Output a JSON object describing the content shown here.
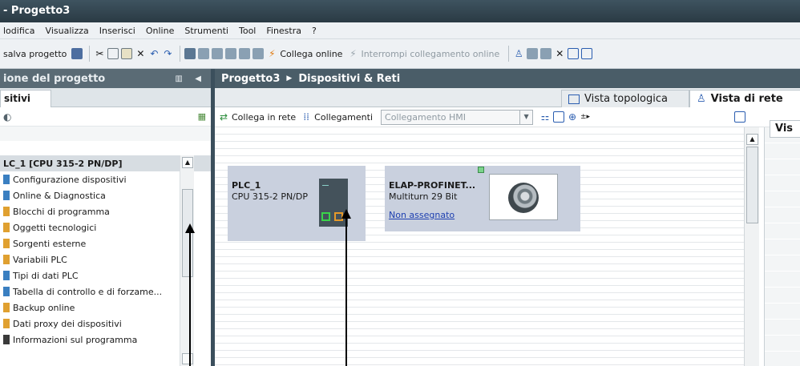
{
  "window": {
    "title": "- Progetto3"
  },
  "menu": [
    "lodifica",
    "Visualizza",
    "Inserisci",
    "Online",
    "Strumenti",
    "Tool",
    "Finestra",
    "?"
  ],
  "toolbar": {
    "save_label": "salva progetto",
    "connect_online_label": "Collega online",
    "disconnect_online_label": "Interrompi collegamento online"
  },
  "project_tree": {
    "header": "ione del progetto",
    "tab_label": "sitivi",
    "items": [
      {
        "label": "LC_1 [CPU 315-2 PN/DP]",
        "icon_color": "#c9d0de"
      },
      {
        "label": "Configurazione dispositivi",
        "icon_color": "#3a7fc1"
      },
      {
        "label": "Online & Diagnostica",
        "icon_color": "#3a7fc1"
      },
      {
        "label": "Blocchi di programma",
        "icon_color": "#e0a030"
      },
      {
        "label": "Oggetti tecnologici",
        "icon_color": "#e0a030"
      },
      {
        "label": "Sorgenti esterne",
        "icon_color": "#e0a030"
      },
      {
        "label": "Variabili PLC",
        "icon_color": "#e0a030"
      },
      {
        "label": "Tipi di dati PLC",
        "icon_color": "#3a7fc1"
      },
      {
        "label": "Tabella di controllo e di forzame...",
        "icon_color": "#3a7fc1"
      },
      {
        "label": "Backup online",
        "icon_color": "#e0a030"
      },
      {
        "label": "Dati proxy dei dispositivi",
        "icon_color": "#e0a030"
      },
      {
        "label": "Informazioni sul programma",
        "icon_color": "#3a3a3a"
      }
    ]
  },
  "editor": {
    "breadcrumb_project": "Progetto3",
    "breadcrumb_section": "Dispositivi & Reti",
    "tab_topology": "Vista topologica",
    "tab_network": "Vista di rete",
    "tab_table": "Vis",
    "connect_network_label": "Collega in rete",
    "connections_label": "Collegamenti",
    "connection_type_value": "Collegamento HMI"
  },
  "devices": {
    "plc": {
      "name": "PLC_1",
      "type": "CPU 315-2 PN/DP"
    },
    "elap": {
      "name": "ELAP-PROFINET...",
      "type": "Multiturn 29 Bit",
      "link": "Non assegnato"
    }
  },
  "colors": {
    "title_bar": "#2f4350",
    "panel_header": "#5a6b75",
    "device_box": "#c9d0de",
    "link": "#1d3fb0"
  }
}
